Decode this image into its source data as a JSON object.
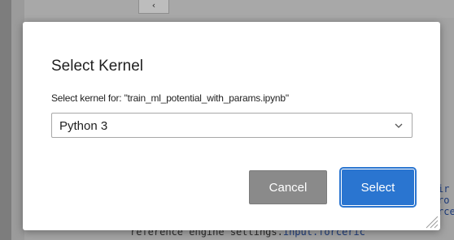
{
  "backdrop": {
    "toolbar_glyph": "‹",
    "code_right": "ir\nro\nrce",
    "code_bottom_prefix": "reference engine settings.",
    "code_bottom_suffix": "input.forceric"
  },
  "dialog": {
    "title": "Select Kernel",
    "label": "Select kernel for: \"train_ml_potential_with_params.ipynb\"",
    "kernel_select": {
      "selected": "Python 3",
      "icon": "chevron-down-icon"
    },
    "cancel_label": "Cancel",
    "select_label": "Select",
    "resize_icon": "resize-grip-icon"
  },
  "colors": {
    "accent": "#2a75d0",
    "cancel_bg": "#8a8a8a",
    "overlay": "#9b9b9b"
  }
}
